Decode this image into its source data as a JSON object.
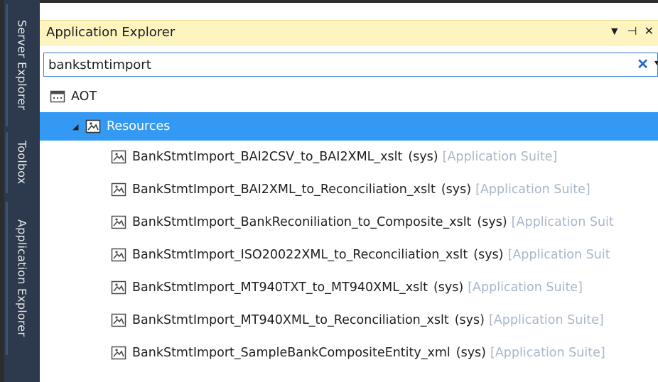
{
  "side_tabs": [
    "Server Explorer",
    "Toolbox",
    "Application Explorer"
  ],
  "panel": {
    "title": "Application Explorer",
    "icons": [
      "dropdown-arrow-icon",
      "pin-icon",
      "close-icon"
    ]
  },
  "search": {
    "value": "bankstmtimport",
    "clear_label": "✕"
  },
  "tree": {
    "root": "AOT",
    "folder": "Resources",
    "items": [
      {
        "name": "BankStmtImport_BAI2CSV_to_BAI2XML_xslt",
        "layer": "(sys)",
        "model": "[Application Suite]"
      },
      {
        "name": "BankStmtImport_BAI2XML_to_Reconciliation_xslt",
        "layer": "(sys)",
        "model": "[Application Suite]"
      },
      {
        "name": "BankStmtImport_BankReconiliation_to_Composite_xslt",
        "layer": "(sys)",
        "model": "[Application Suit"
      },
      {
        "name": "BankStmtImport_ISO20022XML_to_Reconciliation_xslt",
        "layer": "(sys)",
        "model": "[Application Suit"
      },
      {
        "name": "BankStmtImport_MT940TXT_to_MT940XML_xslt",
        "layer": "(sys)",
        "model": "[Application Suite]"
      },
      {
        "name": "BankStmtImport_MT940XML_to_Reconciliation_xslt",
        "layer": "(sys)",
        "model": "[Application Suite]"
      },
      {
        "name": "BankStmtImport_SampleBankCompositeEntity_xml",
        "layer": "(sys)",
        "model": "[Application Suite]"
      }
    ]
  },
  "colors": {
    "title_bar": "#fdf4bf",
    "selection": "#3399f3",
    "side_strip": "#2d3a4e",
    "model_text": "#a9b6c8"
  }
}
